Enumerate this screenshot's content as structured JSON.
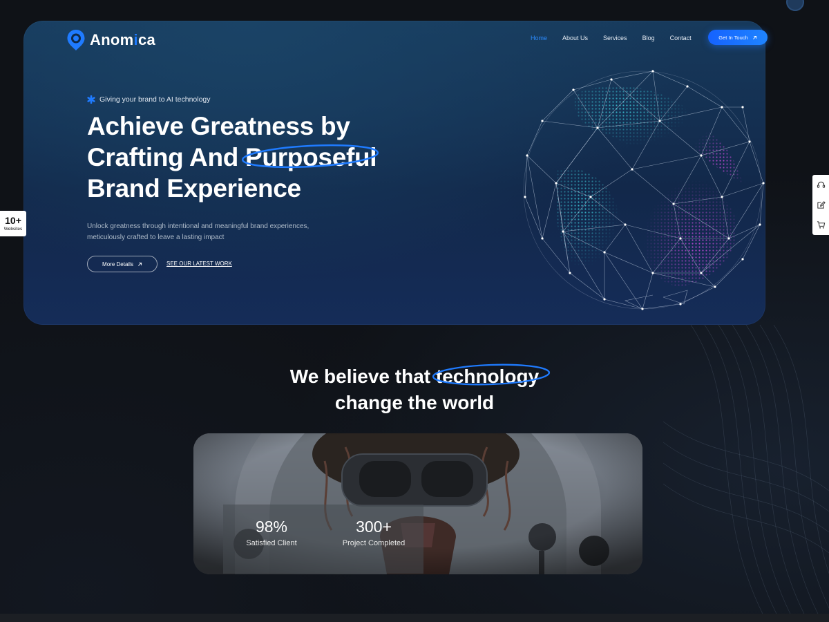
{
  "brand": {
    "name_prefix": "Anom",
    "name_accent": "i",
    "name_suffix": "ca"
  },
  "colors": {
    "accent": "#1f7bff",
    "hero_bg": "#153457",
    "page_bg": "#0f1217"
  },
  "nav": {
    "items": [
      {
        "label": "Home",
        "active": true
      },
      {
        "label": "About Us",
        "active": false
      },
      {
        "label": "Services",
        "active": false
      },
      {
        "label": "Blog",
        "active": false
      },
      {
        "label": "Contact",
        "active": false
      }
    ],
    "cta_label": "Get In Touch"
  },
  "hero": {
    "tagline": "Giving your brand to AI technology",
    "headline_line1": "Achieve Greatness by",
    "headline_line2_pre": "Crafting And ",
    "headline_line2_highlight": "Purposeful",
    "headline_line3": "Brand Experience",
    "description": "Unlock greatness through intentional and meaningful brand experiences, meticulously crafted to leave a lasting impact",
    "primary_button": "More Details",
    "secondary_link": "SEE OUR LATEST WORK"
  },
  "side_badge": {
    "value": "10+",
    "label": "Websites"
  },
  "right_tools": [
    "headset-icon",
    "edit-icon",
    "cart-icon"
  ],
  "section2": {
    "title_pre": "We believe that ",
    "title_highlight": "technology",
    "title_line2": "change the world"
  },
  "stats": [
    {
      "value": "98%",
      "label": "Satisfied Client"
    },
    {
      "value": "300+",
      "label": "Project Completed"
    }
  ]
}
